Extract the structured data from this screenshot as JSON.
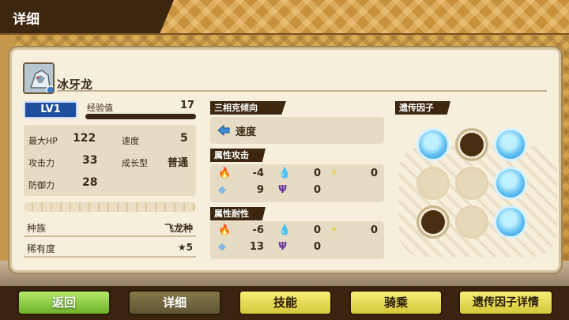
{
  "header": {
    "title": "详细"
  },
  "monster": {
    "name": "冰牙龙",
    "level": "LV1",
    "exp_label": "经验值",
    "exp_value": "17",
    "exp_progress": 0.0
  },
  "stats": {
    "hp_label": "最大HP",
    "hp": "122",
    "speed_label": "速度",
    "speed": "5",
    "atk_label": "攻击力",
    "atk": "33",
    "growth_label": "成长型",
    "growth": "普通",
    "def_label": "防御力",
    "def": "28"
  },
  "info": {
    "race_label": "种族",
    "race": "飞龙种",
    "rarity_label": "稀有度",
    "rarity": "★5"
  },
  "tendency": {
    "header": "三相克倾向",
    "value": "速度"
  },
  "elem_attack": {
    "header": "属性攻击",
    "fire": "-4",
    "water": "0",
    "thunder": "0",
    "ice": "9",
    "dragon": "0"
  },
  "elem_resist": {
    "header": "属性耐性",
    "fire": "-6",
    "water": "0",
    "thunder": "0",
    "ice": "13",
    "dragon": "0"
  },
  "genes": {
    "header": "遗传因子",
    "grid": [
      [
        "blue",
        "brown",
        "blue"
      ],
      [
        "empty",
        "empty",
        "blue"
      ],
      [
        "brown",
        "empty",
        "blue"
      ]
    ]
  },
  "nav": {
    "back": "返回",
    "detail": "详细",
    "skills": "技能",
    "ride": "骑乘",
    "gene_detail": "遗传因子详情"
  },
  "colors": {
    "fire": "#e8501e",
    "water": "#3aa0e0",
    "thunder": "#e8c800",
    "ice": "#7fb8e8",
    "dragon": "#6a3aa0",
    "header_dark": "#3d2710"
  }
}
